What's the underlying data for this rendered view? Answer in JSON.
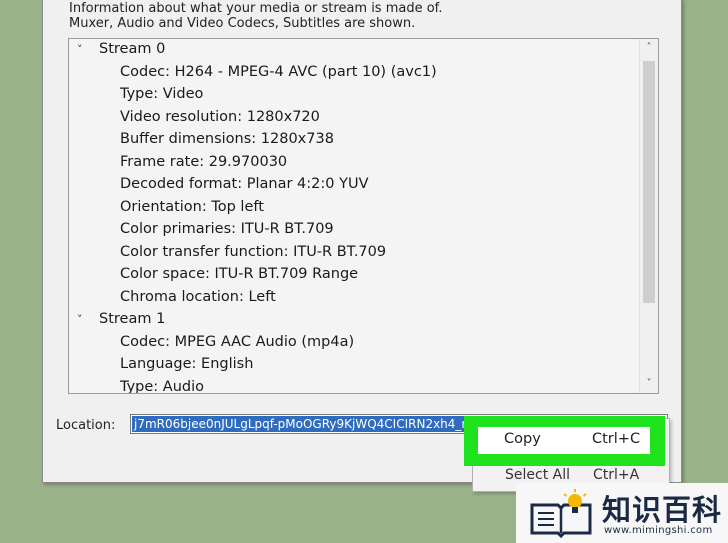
{
  "dialog": {
    "intro_line1": "Information about what your media or stream is made of.",
    "intro_line2": "Muxer, Audio and Video Codecs, Subtitles are shown."
  },
  "tree": {
    "streams": [
      {
        "label": "Stream 0",
        "properties": [
          "Codec: H264 - MPEG-4 AVC (part 10) (avc1)",
          "Type: Video",
          "Video resolution: 1280x720",
          "Buffer dimensions: 1280x738",
          "Frame rate: 29.970030",
          "Decoded format: Planar 4:2:0 YUV",
          "Orientation: Top left",
          "Color primaries: ITU-R BT.709",
          "Color transfer function: ITU-R BT.709",
          "Color space: ITU-R BT.709 Range",
          "Chroma location: Left"
        ]
      },
      {
        "label": "Stream 1",
        "properties": [
          "Codec: MPEG AAC Audio (mp4a)",
          "Language: English",
          "Type: Audio"
        ]
      }
    ]
  },
  "location": {
    "label": "Location:",
    "value": "j7mR06bjee0nJULgLpqf-pMoOGRy9KjWQ4CICIRN2xh4_rh"
  },
  "context_menu": {
    "items": [
      {
        "label": "Copy",
        "shortcut": "Ctrl+C"
      },
      {
        "label": "Select All",
        "shortcut": "Ctrl+A"
      }
    ]
  },
  "watermark": {
    "cn_text": "知识百科",
    "url": "www.mimingshi.com"
  },
  "colors": {
    "background": "#9ab28a",
    "highlight": "#1ee21e",
    "selection": "#2f6cc0"
  }
}
